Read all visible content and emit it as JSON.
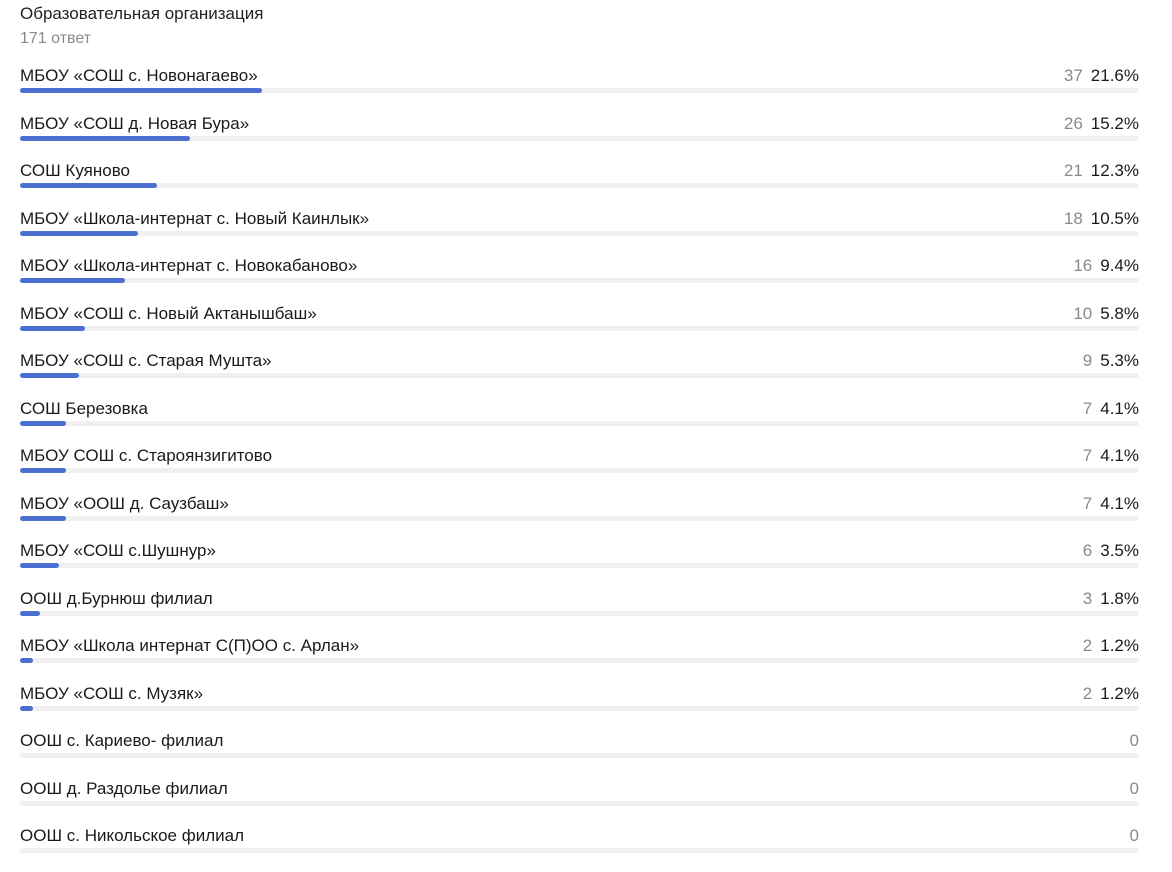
{
  "header": {
    "title": "Образовательная организация",
    "subtitle": "171 ответ"
  },
  "colors": {
    "bar_fill": "#4a6fd1",
    "bar_track": "#f0f0f0"
  },
  "chart_data": {
    "type": "bar",
    "orientation": "horizontal",
    "title": "Образовательная организация",
    "total_responses": 171,
    "xlim": [
      0,
      100
    ],
    "categories": [
      "МБОУ «СОШ с. Новонагаево»",
      "МБОУ «СОШ д. Новая Бура»",
      "СОШ Куяново",
      "МБОУ «Школа-интернат с. Новый Каинлык»",
      "МБОУ «Школа-интернат с. Новокабаново»",
      "МБОУ «СОШ с. Новый Актанышбаш»",
      "МБОУ «СОШ с. Старая Мушта»",
      "СОШ Березовка",
      "МБОУ СОШ с. Староянзигитово",
      "МБОУ «ООШ д. Саузбаш»",
      "МБОУ «СОШ с.Шушнур»",
      "ООШ д.Бурнюш филиал",
      "МБОУ «Школа интернат С(П)ОО с. Арлан»",
      "МБОУ «СОШ с. Музяк»",
      "ООШ с. Кариево- филиал",
      "ООШ д. Раздолье филиал",
      "ООШ с. Никольское филиал"
    ],
    "series": [
      {
        "values": [
          37,
          26,
          21,
          18,
          16,
          10,
          9,
          7,
          7,
          7,
          6,
          3,
          2,
          2,
          0,
          0,
          0
        ],
        "percent_labels": [
          "21.6%",
          "15.2%",
          "12.3%",
          "10.5%",
          "9.4%",
          "5.8%",
          "5.3%",
          "4.1%",
          "4.1%",
          "4.1%",
          "3.5%",
          "1.8%",
          "1.2%",
          "1.2%",
          "",
          "",
          ""
        ]
      }
    ]
  }
}
